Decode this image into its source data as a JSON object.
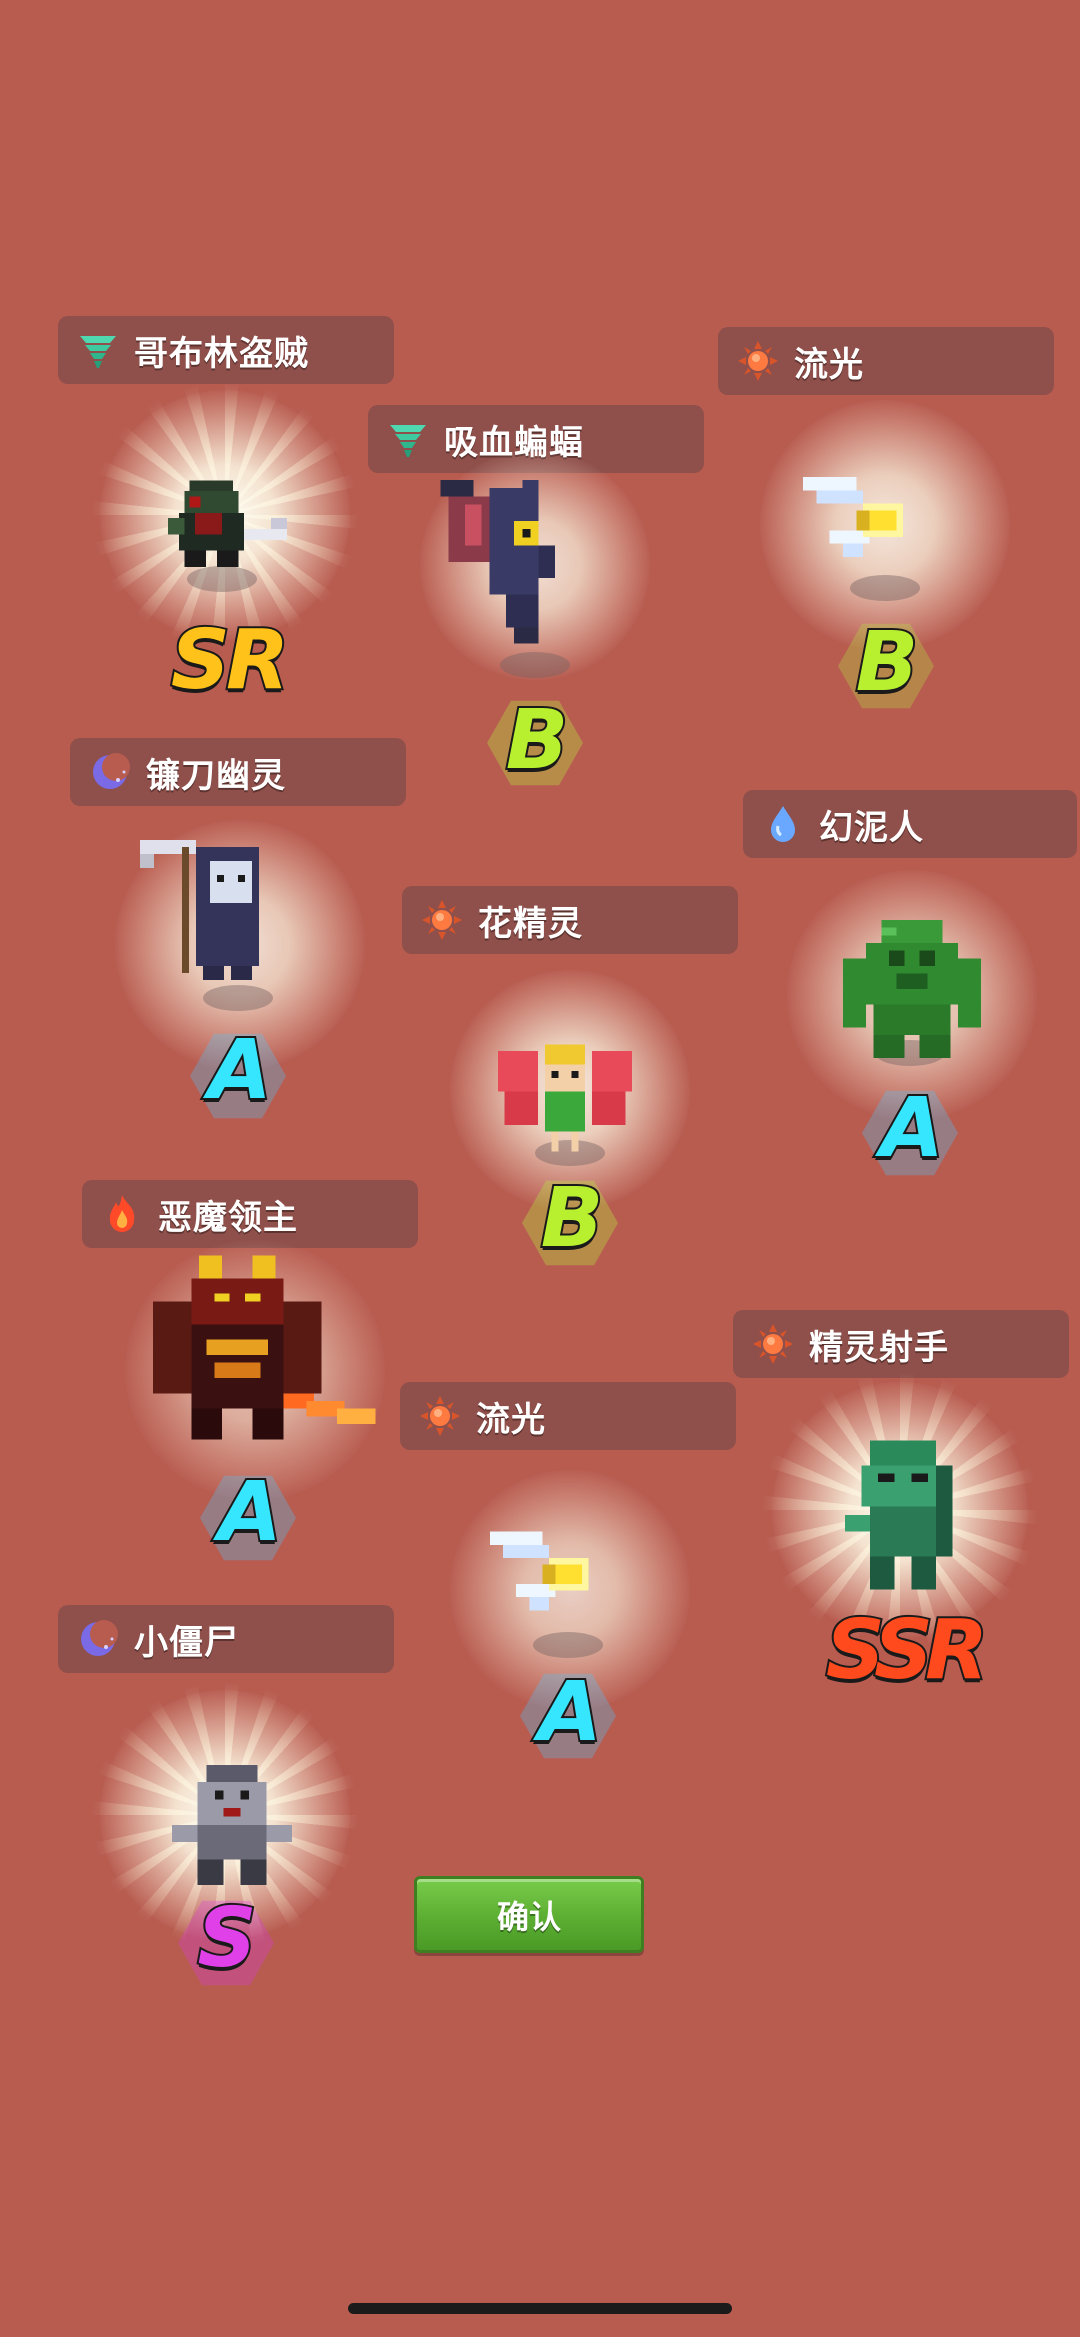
{
  "units": [
    {
      "id": "u1",
      "name": "哥布林盗贼",
      "element": "wind",
      "rank": "SR"
    },
    {
      "id": "u2",
      "name": "吸血蝙蝠",
      "element": "wind",
      "rank": "B"
    },
    {
      "id": "u3",
      "name": "流光",
      "element": "sun",
      "rank": "B"
    },
    {
      "id": "u4",
      "name": "镰刀幽灵",
      "element": "moon",
      "rank": "A"
    },
    {
      "id": "u5",
      "name": "幻泥人",
      "element": "water",
      "rank": "A"
    },
    {
      "id": "u6",
      "name": "花精灵",
      "element": "sun",
      "rank": "B"
    },
    {
      "id": "u7",
      "name": "恶魔领主",
      "element": "fire",
      "rank": "A"
    },
    {
      "id": "u8",
      "name": "流光",
      "element": "sun",
      "rank": "A"
    },
    {
      "id": "u9",
      "name": "精灵射手",
      "element": "sun",
      "rank": "SSR"
    },
    {
      "id": "u10",
      "name": "小僵尸",
      "element": "moon",
      "rank": "S"
    }
  ],
  "confirm_button": {
    "label": "确认"
  },
  "colors": {
    "background": "#b85c50",
    "rank_SSR": "#ff4a1e",
    "rank_SR": "#ffc21a",
    "rank_S": "#e040e8",
    "rank_A": "#36e6ff",
    "rank_B": "#b8f030",
    "wind": "#3ec9a0",
    "sun": "#ff6a30",
    "moon": "#7a6ae6",
    "water": "#6aa8ff",
    "fire": "#ff4a2a"
  }
}
